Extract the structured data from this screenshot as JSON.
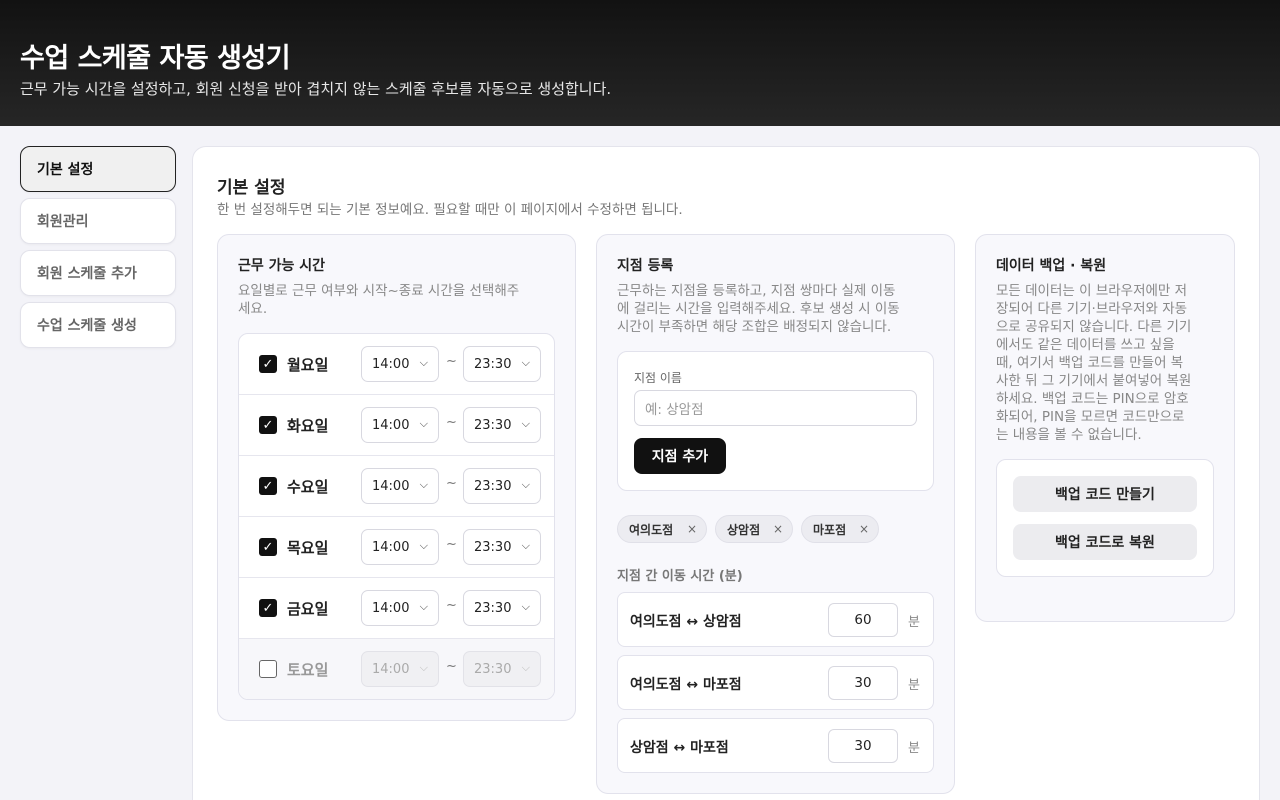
{
  "header": {
    "title": "수업 스케줄 자동 생성기",
    "subtitle": "근무 가능 시간을 설정하고, 회원 신청을 받아 겹치지 않는 스케줄 후보를 자동으로 생성합니다."
  },
  "sidebar": {
    "items": [
      {
        "label": "기본 설정",
        "active": true
      },
      {
        "label": "회원관리",
        "active": false
      },
      {
        "label": "회원 스케줄 추가",
        "active": false
      },
      {
        "label": "수업 스케줄 생성",
        "active": false
      }
    ]
  },
  "main": {
    "title": "기본 설정",
    "description": "한 번 설정해두면 되는 기본 정보예요. 필요할 때만 이 페이지에서 수정하면 됩니다."
  },
  "availability": {
    "title": "근무 가능 시간",
    "description_lines": [
      "요일별로 근무 여부와 시작~종료 시간을 선택해주",
      "세요."
    ],
    "separator": "~",
    "days": [
      {
        "label": "월요일",
        "checked": true,
        "start": "14:00",
        "end": "23:30"
      },
      {
        "label": "화요일",
        "checked": true,
        "start": "14:00",
        "end": "23:30"
      },
      {
        "label": "수요일",
        "checked": true,
        "start": "14:00",
        "end": "23:30"
      },
      {
        "label": "목요일",
        "checked": true,
        "start": "14:00",
        "end": "23:30"
      },
      {
        "label": "금요일",
        "checked": true,
        "start": "14:00",
        "end": "23:30"
      },
      {
        "label": "토요일",
        "checked": false,
        "start": "14:00",
        "end": "23:30"
      }
    ]
  },
  "branches": {
    "title": "지점 등록",
    "description_lines": [
      "근무하는 지점을 등록하고, 지점 쌍마다 실제 이동",
      "에 걸리는 시간을 입력해주세요. 후보 생성 시 이동",
      "시간이 부족하면 해당 조합은 배정되지 않습니다."
    ],
    "name_label": "지점 이름",
    "name_placeholder": "예: 상암점",
    "add_button": "지점 추가",
    "chips": [
      "여의도점",
      "상암점",
      "마포점"
    ],
    "chip_remove": "×",
    "travel_label": "지점 간 이동 시간 (분)",
    "pairs": [
      {
        "name": "여의도점 ↔ 상암점",
        "minutes": "60"
      },
      {
        "name": "여의도점 ↔ 마포점",
        "minutes": "30"
      },
      {
        "name": "상암점 ↔ 마포점",
        "minutes": "30"
      }
    ],
    "unit": "분"
  },
  "backup": {
    "title": "데이터 백업 · 복원",
    "description_lines": [
      "모든 데이터는 이 브라우저에만 저",
      "장되어 다른 기기·브라우저와 자동",
      "으로 공유되지 않습니다. 다른 기기",
      "에서도 같은 데이터를 쓰고 싶을",
      "때, 여기서 백업 코드를 만들어 복",
      "사한 뒤 그 기기에서 붙여넣어 복원",
      "하세요. 백업 코드는 PIN으로 암호",
      "화되어, PIN을 모르면 코드만으로",
      "는 내용을 볼 수 없습니다."
    ],
    "create_button": "백업 코드 만들기",
    "restore_button": "백업 코드로 복원"
  }
}
